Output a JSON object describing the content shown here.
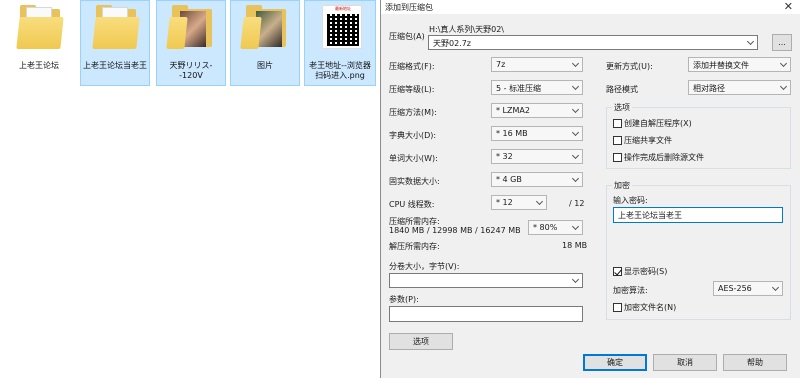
{
  "desktop": {
    "files": [
      {
        "name": "上老王论坛",
        "type": "folder"
      },
      {
        "name": "上老王论坛当老王",
        "type": "folder"
      },
      {
        "name": "天野リリス--120V",
        "type": "folder-photo"
      },
      {
        "name": "图片",
        "type": "folder-photo"
      },
      {
        "name": "老王地址--浏览器扫码进入.png",
        "type": "image-qr",
        "qr_caption": "最新地址"
      }
    ]
  },
  "dialog": {
    "title": "添加到压缩包",
    "close_glyph": "✕",
    "archive": {
      "label": "压缩包(A)",
      "path": "H:\\真人系列\\天野02\\",
      "value": "天野02.7z",
      "browse_label": "..."
    },
    "left": {
      "format": {
        "label": "压缩格式(F):",
        "value": "7z"
      },
      "level": {
        "label": "压缩等级(L):",
        "value": "5 - 标准压缩"
      },
      "method": {
        "label": "压缩方法(M):",
        "value": "* LZMA2"
      },
      "dict": {
        "label": "字典大小(D):",
        "value": "* 16 MB"
      },
      "word": {
        "label": "单词大小(W):",
        "value": "* 32"
      },
      "solid": {
        "label": "固实数据大小:",
        "value": "* 4 GB"
      },
      "cpu": {
        "label": "CPU 线程数:",
        "value": "* 12",
        "max": "/ 12"
      },
      "mem_comp": {
        "label": "压缩所需内存:",
        "detail": "1840 MB / 12998 MB / 16247 MB",
        "percent": "* 80%"
      },
      "mem_decomp": {
        "label": "解压所需内存:",
        "value": "18 MB"
      },
      "split": {
        "label": "分卷大小，字节(V):",
        "value": ""
      },
      "params": {
        "label": "参数(P):",
        "value": ""
      },
      "options_btn": "选项"
    },
    "right": {
      "update": {
        "label": "更新方式(U):",
        "value": "添加并替换文件"
      },
      "pathmode": {
        "label": "路径模式",
        "value": "相对路径"
      },
      "options": {
        "title": "选项",
        "sfx": "创建自解压程序(X)",
        "shared": "压缩共享文件",
        "delete": "操作完成后删除源文件"
      },
      "encryption": {
        "title": "加密",
        "password_label": "输入密码:",
        "password_value": "上老王论坛当老王",
        "show_password": "显示密码(S)",
        "method_label": "加密算法:",
        "method_value": "AES-256",
        "encrypt_names": "加密文件名(N)"
      }
    },
    "buttons": {
      "ok": "确定",
      "cancel": "取消",
      "help": "帮助"
    }
  }
}
